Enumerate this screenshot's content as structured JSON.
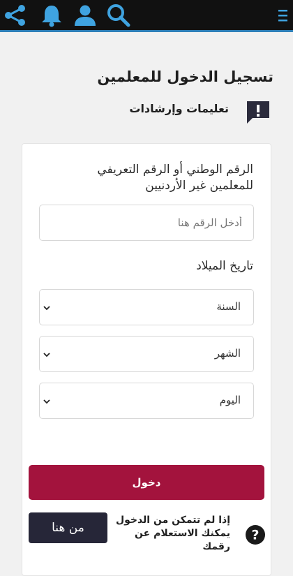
{
  "header": {
    "icons": [
      "share-icon",
      "bell-icon",
      "user-icon",
      "search-icon",
      "menu-icon"
    ],
    "accent_color": "#2e7fb8"
  },
  "page": {
    "title": "تسجيل الدخول للمعلمين",
    "notice_label": "تعليمات وإرشادات"
  },
  "form": {
    "id_label": "الرقم الوطني أو الرقم التعريفي للمعلمين غير الأردنيين",
    "id_placeholder": "أدخل الرقم هنا",
    "dob_label": "تاريخ الميلاد",
    "year": "السنة",
    "month": "الشهر",
    "day": "اليوم",
    "submit_label": "دخول",
    "submit_color": "#a3133d"
  },
  "help": {
    "text": "إذا لم تتمكن من الدخول يمكنك الاستعلام عن رقمك",
    "button_label": "من هنا"
  }
}
